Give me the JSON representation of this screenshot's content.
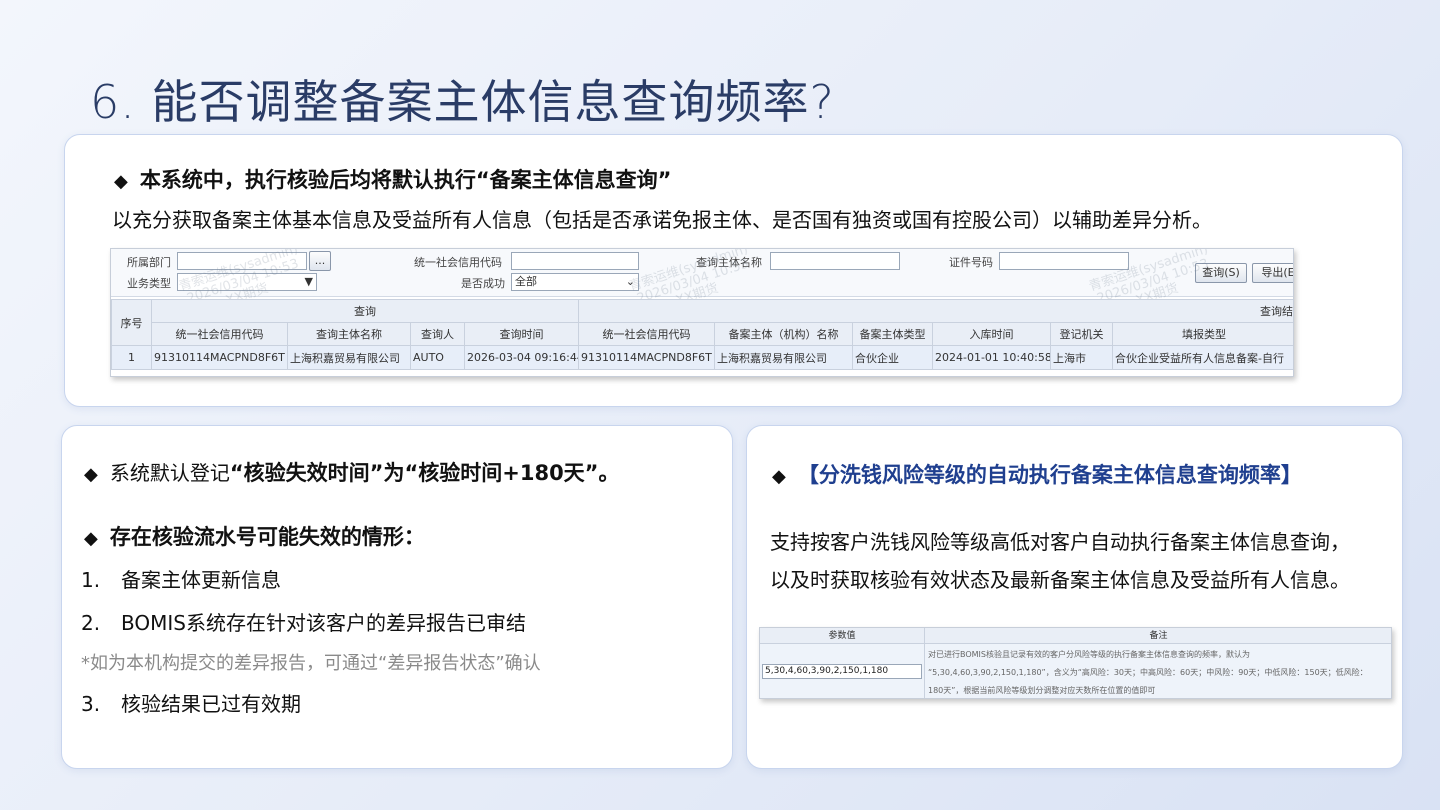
{
  "slide": {
    "title": "6. 能否调整备案主体信息查询频率?"
  },
  "top_card": {
    "bullet": "◆",
    "heading": "本系统中，执行核验后均将默认执行“备案主体信息查询”",
    "body": "以充分获取备案主体基本信息及受益所有人信息（包括是否承诺免报主体、是否国有独资或国有控股公司）以辅助差异分析。"
  },
  "query_screen": {
    "filters": {
      "dept_label": "所属部门",
      "dept_btn": "...",
      "business_type_label": "业务类型",
      "credit_code_label": "统一社会信用代码",
      "success_label": "是否成功",
      "success_value": "全部",
      "subject_name_label": "查询主体名称",
      "cert_no_label": "证件号码",
      "query_button": "查询(S)",
      "export_button": "导出(E"
    },
    "watermark": {
      "line1": "青索运维(sysadmin)",
      "line2": "2026/03/04 10:53",
      "line3": "XX期货"
    },
    "group_headers": {
      "seq": "序号",
      "query": "查询",
      "result": "查询结"
    },
    "columns": [
      "统一社会信用代码",
      "查询主体名称",
      "查询人",
      "查询时间",
      "统一社会信用代码",
      "备案主体（机构）名称",
      "备案主体类型",
      "入库时间",
      "登记机关",
      "填报类型"
    ],
    "rows": [
      [
        "1",
        "91310114MACPND8F6T",
        "上海积嘉贸易有限公司",
        "AUTO",
        "2026-03-04 09:16:44",
        "91310114MACPND8F6T",
        "上海积嘉贸易有限公司",
        "合伙企业",
        "2024-01-01 10:40:58",
        "上海市",
        "合伙企业受益所有人信息备案-自行"
      ]
    ]
  },
  "left_card": {
    "bullet": "◆",
    "line1_prefix": "系统默认登记",
    "line1_bold": "“核验失效时间”为“核验时间+180天”。",
    "heading2": "存在核验流水号可能失效的情形：",
    "items": [
      {
        "num": "1.",
        "text": "备案主体更新信息"
      },
      {
        "num": "2.",
        "text": "BOMIS系统存在针对该客户的差异报告已审结"
      },
      {
        "num": "3.",
        "text": "核验结果已过有效期"
      }
    ],
    "note": "*如为本机构提交的差异报告，可通过“差异报告状态”确认"
  },
  "right_card": {
    "bullet": "◆",
    "heading": "【分洗钱风险等级的自动执行备案主体信息查询频率】",
    "body_line1": "支持按客户洗钱风险等级高低对客户自动执行备案主体信息查询，",
    "body_line2": "以及时获取核验有效状态及最新备案主体信息及受益所有人信息。"
  },
  "param_screen": {
    "col_value": "参数值",
    "col_remark": "备注",
    "value": "5,30,4,60,3,90,2,150,1,180",
    "remark_line1": "对已进行BOMIS核验且记录有效的客户分风险等级的执行备案主体信息查询的频率，默认为",
    "remark_line2": "“5,30,4,60,3,90,2,150,1,180”，含义为“高风险：30天；中高风险：60天；中风险：90天；中低风险：150天；低风险：",
    "remark_line3": "180天”，根据当前风险等级划分调整对应天数所在位置的值即可"
  },
  "colors": {
    "title": "#2a3c66",
    "accent_blue": "#1f3f8f",
    "note_gray": "#8a8a8a"
  }
}
